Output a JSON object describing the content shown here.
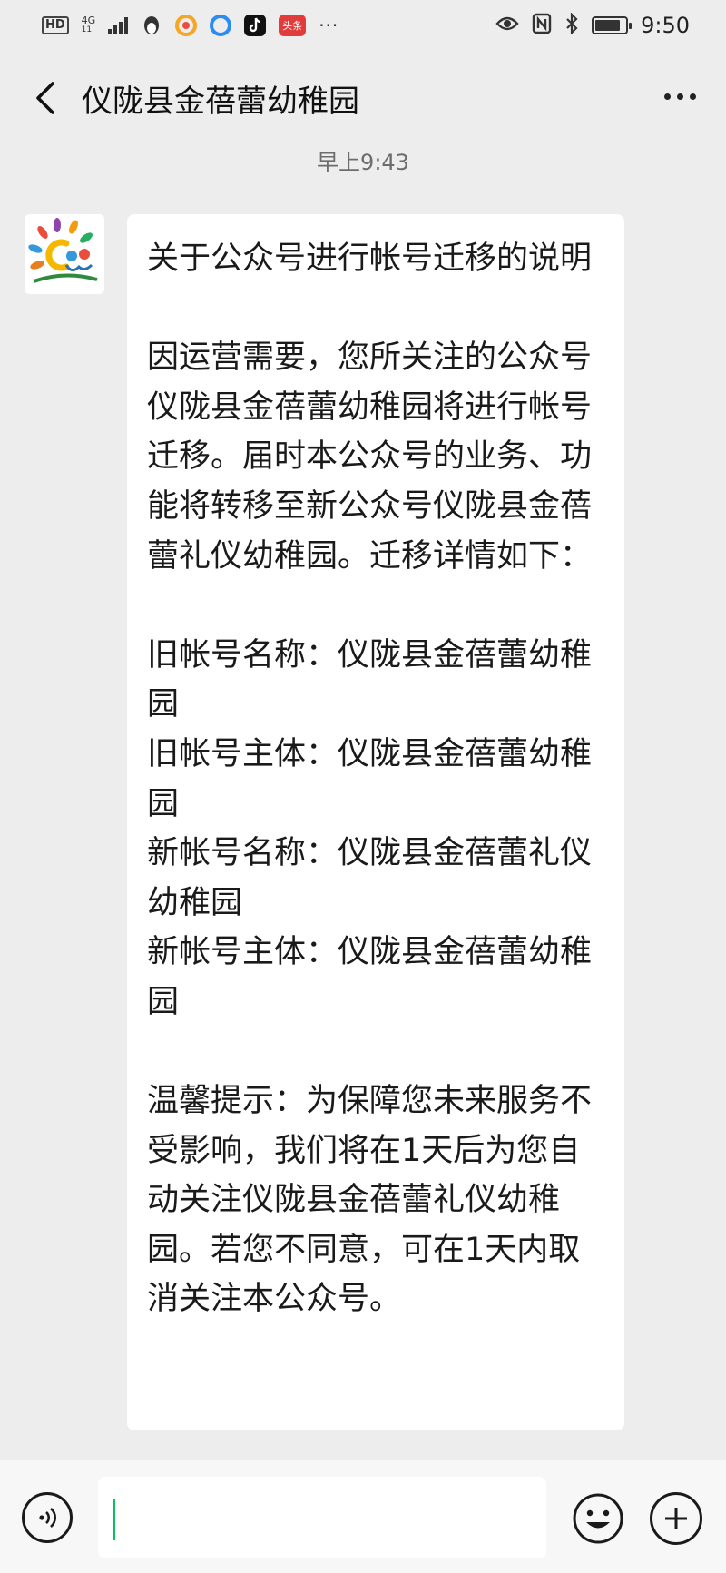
{
  "status_bar": {
    "hd": "HD",
    "network_type": "4G",
    "network_sub": "11",
    "app_icons": [
      {
        "icon": "qq-penguin-icon",
        "color": "#333333"
      },
      {
        "icon": "circle-app-icon",
        "color": "#f5a623"
      },
      {
        "icon": "browser-app-icon",
        "color": "#2d8cf0"
      },
      {
        "icon": "tiktok-icon",
        "color": "#111111"
      },
      {
        "icon": "toutiao-icon",
        "color": "#e23b3b",
        "label": "头条"
      }
    ],
    "more_dots": "···",
    "right_icons": [
      "eye-icon",
      "nfc-icon",
      "bluetooth-icon",
      "battery-icon"
    ],
    "battery_level": 0.85,
    "time": "9:50"
  },
  "nav": {
    "title": "仪陇县金蓓蕾幼稚园",
    "back_icon": "chevron-left-icon",
    "more_icon": "more-dots-icon"
  },
  "chat": {
    "timestamp": "早上9:43",
    "message": {
      "sender_avatar": "kindergarten-logo-avatar",
      "text": "关于公众号进行帐号迁移的说明\n\n因运营需要，您所关注的公众号仪陇县金蓓蕾幼稚园将进行帐号迁移。届时本公众号的业务、功能将转移至新公众号仪陇县金蓓蕾礼仪幼稚园。迁移详情如下：\n\n旧帐号名称：仪陇县金蓓蕾幼稚园\n旧帐号主体：仪陇县金蓓蕾幼稚园\n新帐号名称：仪陇县金蓓蕾礼仪幼稚园\n新帐号主体：仪陇县金蓓蕾幼稚园\n\n温馨提示：为保障您未来服务不受影响，我们将在1天后为您自动关注仪陇县金蓓蕾礼仪幼稚园。若您不同意，可在1天内取消关注本公众号。"
    }
  },
  "input_bar": {
    "voice_icon": "voice-input-icon",
    "text_value": "",
    "emoji_icon": "emoji-icon",
    "plus_icon": "plus-icon",
    "caret_color": "#07c160"
  }
}
